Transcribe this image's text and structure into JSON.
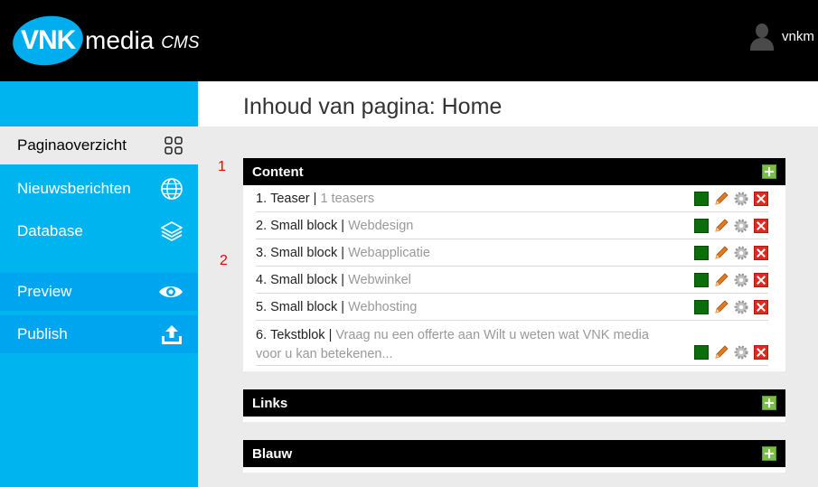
{
  "header": {
    "logo_vnk": "VNK",
    "logo_media": "media",
    "logo_cms": "CMS",
    "user_name": "vnkm"
  },
  "sidebar": {
    "items": [
      {
        "label": "Paginaoverzicht",
        "icon": "grid-icon"
      },
      {
        "label": "Nieuwsberichten",
        "icon": "globe-icon"
      },
      {
        "label": "Database",
        "icon": "layers-icon"
      },
      {
        "label": "Preview",
        "icon": "eye-icon"
      },
      {
        "label": "Publish",
        "icon": "upload-icon"
      }
    ]
  },
  "page": {
    "title": "Inhoud van pagina: Home"
  },
  "markers": [
    "1",
    "2"
  ],
  "panels": {
    "content": {
      "title": "Content",
      "rows": [
        {
          "num": "1.",
          "name": "Teaser",
          "sep": " | ",
          "sub": "1 teasers"
        },
        {
          "num": "2.",
          "name": "Small block",
          "sep": " | ",
          "sub": "Webdesign"
        },
        {
          "num": "3.",
          "name": "Small block",
          "sep": " | ",
          "sub": "Webapplicatie"
        },
        {
          "num": "4.",
          "name": "Small block",
          "sep": " | ",
          "sub": "Webwinkel"
        },
        {
          "num": "5.",
          "name": "Small block",
          "sep": " | ",
          "sub": "Webhosting"
        },
        {
          "num": "6.",
          "name": "Tekstblok",
          "sep": " | ",
          "sub": "Vraag nu een offerte aan Wilt u weten wat VNK media voor u kan betekenen..."
        }
      ]
    },
    "links": {
      "title": "Links"
    },
    "blauw": {
      "title": "Blauw"
    }
  },
  "colors": {
    "header_bg": "#000000",
    "sidebar_bg": "#00b4f0",
    "accent_blue": "#00aeef",
    "status_green": "#0a6e0a",
    "add_green": "#7ac142",
    "delete_red": "#e02a1f",
    "marker_red": "#ee0000"
  }
}
